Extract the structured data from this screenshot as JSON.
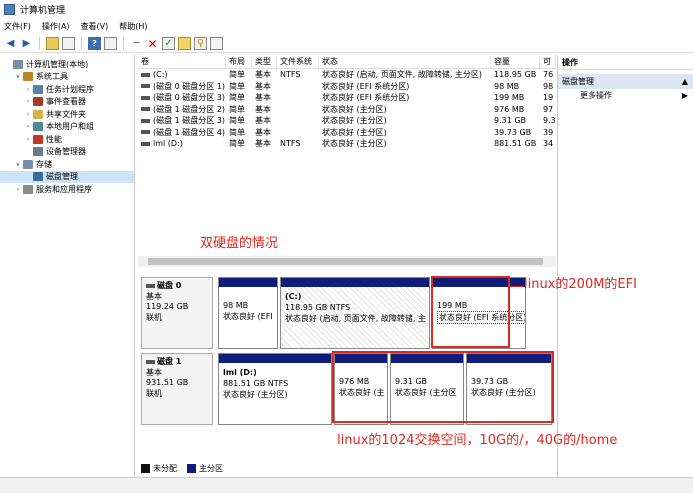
{
  "window": {
    "title": "计算机管理"
  },
  "menu": [
    "文件(F)",
    "操作(A)",
    "查看(V)",
    "帮助(H)"
  ],
  "tree": [
    {
      "label": "计算机管理(本地)",
      "indent": 0,
      "exp": "",
      "color": "#7a8ea8"
    },
    {
      "label": "系统工具",
      "indent": 1,
      "exp": "v",
      "color": "#b8892a"
    },
    {
      "label": "任务计划程序",
      "indent": 2,
      "exp": ">",
      "color": "#5b7fa6"
    },
    {
      "label": "事件查看器",
      "indent": 2,
      "exp": ">",
      "color": "#a83a2a"
    },
    {
      "label": "共享文件夹",
      "indent": 2,
      "exp": ">",
      "color": "#d6b34a"
    },
    {
      "label": "本地用户和组",
      "indent": 2,
      "exp": ">",
      "color": "#4c8a9a"
    },
    {
      "label": "性能",
      "indent": 2,
      "exp": ">",
      "color": "#c0392b"
    },
    {
      "label": "设备管理器",
      "indent": 2,
      "exp": "",
      "color": "#6b7c8a"
    },
    {
      "label": "存储",
      "indent": 1,
      "exp": "v",
      "color": "#7a8ea8"
    },
    {
      "label": "磁盘管理",
      "indent": 2,
      "exp": "",
      "color": "#3b6aa0",
      "selected": true
    },
    {
      "label": "服务和应用程序",
      "indent": 1,
      "exp": ">",
      "color": "#8a8a8a"
    }
  ],
  "volumes": {
    "headers": [
      "卷",
      "布局",
      "类型",
      "文件系统",
      "状态",
      "容量",
      "可"
    ],
    "rows": [
      [
        "(C:)",
        "简单",
        "基本",
        "NTFS",
        "状态良好 (启动, 页面文件, 故障转储, 主分区)",
        "118.95 GB",
        "76"
      ],
      [
        "(磁盘 0 磁盘分区 1)",
        "简单",
        "基本",
        "",
        "状态良好 (EFI 系统分区)",
        "98 MB",
        "98"
      ],
      [
        "(磁盘 0 磁盘分区 3)",
        "简单",
        "基本",
        "",
        "状态良好 (EFI 系统分区)",
        "199 MB",
        "19"
      ],
      [
        "(磁盘 1 磁盘分区 2)",
        "简单",
        "基本",
        "",
        "状态良好 (主分区)",
        "976 MB",
        "97"
      ],
      [
        "(磁盘 1 磁盘分区 3)",
        "简单",
        "基本",
        "",
        "状态良好 (主分区)",
        "9.31 GB",
        "9.3"
      ],
      [
        "(磁盘 1 磁盘分区 4)",
        "简单",
        "基本",
        "",
        "状态良好 (主分区)",
        "39.73 GB",
        "39"
      ],
      [
        "lml (D:)",
        "简单",
        "基本",
        "NTFS",
        "状态良好 (主分区)",
        "881.51 GB",
        "34"
      ]
    ]
  },
  "disk0": {
    "name": "磁盘 0",
    "type": "基本",
    "size": "119.24 GB",
    "status": "联机",
    "parts": [
      {
        "title": "",
        "size": "98 MB",
        "status": "状态良好 (EFI"
      },
      {
        "title": "(C:)",
        "size": "118.95 GB NTFS",
        "status": "状态良好 (启动, 页面文件, 故障转储, 主"
      },
      {
        "title": "",
        "size": "199 MB",
        "status": "状态良好 (EFI 系统分区)"
      }
    ]
  },
  "disk1": {
    "name": "磁盘 1",
    "type": "基本",
    "size": "931.51 GB",
    "status": "联机",
    "parts": [
      {
        "title": "lml (D:)",
        "size": "881.51 GB NTFS",
        "status": "状态良好 (主分区)"
      },
      {
        "title": "",
        "size": "976 MB",
        "status": "状态良好 (主"
      },
      {
        "title": "",
        "size": "9.31 GB",
        "status": "状态良好 (主分区"
      },
      {
        "title": "",
        "size": "39.73 GB",
        "status": "状态良好 (主分区)"
      }
    ]
  },
  "legend": [
    "未分配",
    "主分区"
  ],
  "actions": {
    "header": "操作",
    "group": "磁盘管理",
    "item": "更多操作"
  },
  "annotations": {
    "double_disk": "双硬盘的情况",
    "efi": "linux的200M的EFI",
    "partitions": "linux的1024交换空间，10G的/，40G的/home"
  },
  "colors": {
    "annotation": "#e0281e",
    "partition_bar": "#0f1c78",
    "selection": "#cce4f7"
  }
}
